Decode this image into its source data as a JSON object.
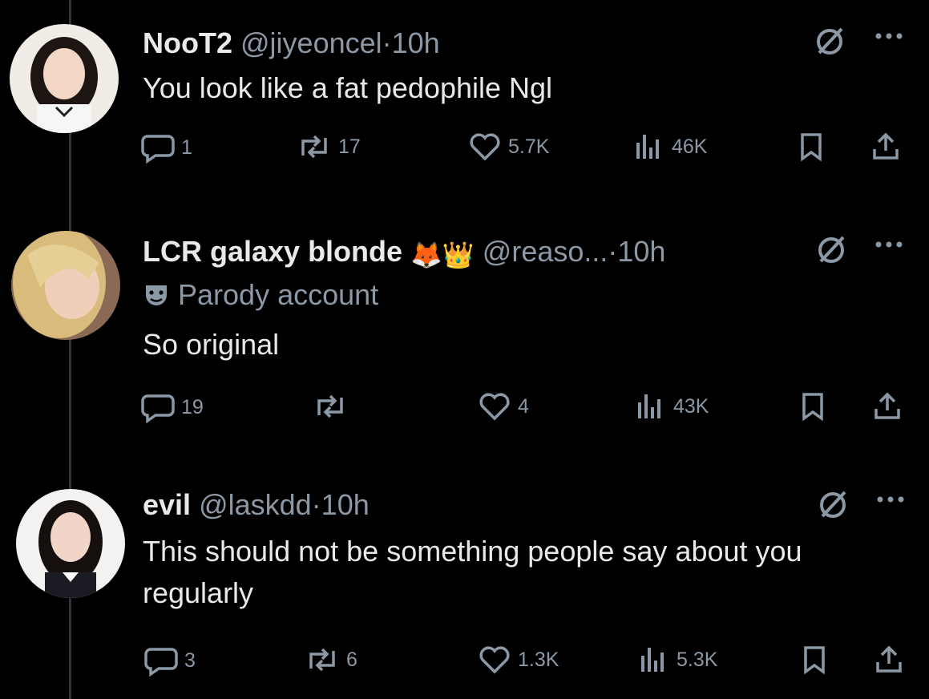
{
  "tweets": [
    {
      "name": "NooT2",
      "handle": "@jiyeoncel",
      "separator": "·",
      "time": "10h",
      "text": "You look like a fat pedophile Ngl",
      "replies": "1",
      "reposts": "17",
      "likes": "5.7K",
      "views": "46K"
    },
    {
      "name": "LCR galaxy blonde",
      "name_emoji": "🦊👑",
      "handle": "@reaso...",
      "separator": "·",
      "time": "10h",
      "badge_label": "Parody account",
      "text": "So original",
      "replies": "19",
      "reposts": "",
      "likes": "4",
      "views": "43K"
    },
    {
      "name": "evil",
      "handle": "@laskdd",
      "separator": "·",
      "time": "10h",
      "text": "This should not be something people say about you regularly",
      "replies": "3",
      "reposts": "6",
      "likes": "1.3K",
      "views": "5.3K"
    }
  ],
  "icons": {
    "reply": "speech-bubble-icon",
    "repost": "repost-arrows-icon",
    "like": "heart-icon",
    "views": "bar-chart-icon",
    "bookmark": "bookmark-icon",
    "share": "share-upload-icon",
    "grok": "grok-slash-circle-icon",
    "more": "ellipsis-icon",
    "parody": "theater-mask-icon"
  },
  "colors": {
    "background": "#000000",
    "text": "#e7e9ea",
    "muted": "#8b98a5",
    "thread_line": "#2f3336"
  }
}
